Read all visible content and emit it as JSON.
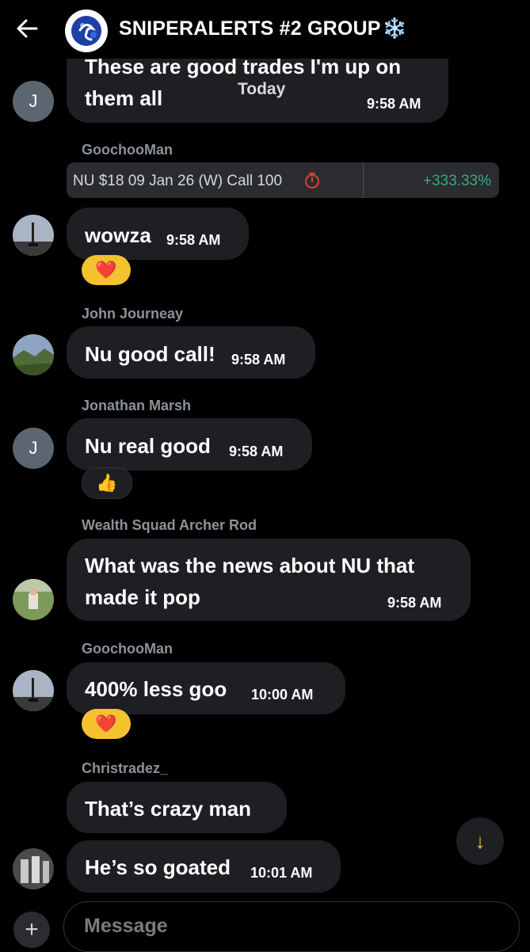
{
  "header": {
    "back_icon": "arrow-left-icon",
    "title": "SNIPERALERTS #2 GROUP",
    "snow_icon": "❄️",
    "avatar_icon": "group-avatar-icon"
  },
  "date_divider": "Today",
  "messages": [
    {
      "text1": "These are good trades I'm up on",
      "text2": "them all",
      "time": "9:58 AM",
      "avatar_letter": "J"
    },
    {
      "sender": "GoochooMan",
      "trade_label": "NU $18 09 Jan 26 (W) Call 100",
      "trade_pct": "+333.33%",
      "timer_icon": "stopwatch-icon"
    },
    {
      "text": "wowza",
      "time": "9:58 AM",
      "reaction": "❤️"
    },
    {
      "sender": "John Journeay",
      "text": "Nu good call!",
      "time": "9:58 AM"
    },
    {
      "sender": "Jonathan Marsh",
      "text": "Nu real good",
      "time": "9:58 AM",
      "reaction": "👍",
      "avatar_letter": "J"
    },
    {
      "sender": "Wealth Squad Archer Rod",
      "text1": "What was the news about NU that",
      "text2": "made it pop",
      "time": "9:58 AM"
    },
    {
      "sender": "GoochooMan",
      "text": "400% less goo",
      "time": "10:00 AM",
      "reaction": "❤️"
    },
    {
      "sender": "Christradez_",
      "text": "That’s crazy man"
    },
    {
      "text": "He’s so goated",
      "time": "10:01 AM"
    }
  ],
  "composer": {
    "placeholder": "Message",
    "plus_label": "+"
  },
  "scroll_down_icon": "↓",
  "colors": {
    "background": "#000000",
    "bubble": "#1d1f23",
    "sender": "#8b9299",
    "gain": "#3ba97b",
    "reaction_gold": "#f4c22f"
  }
}
